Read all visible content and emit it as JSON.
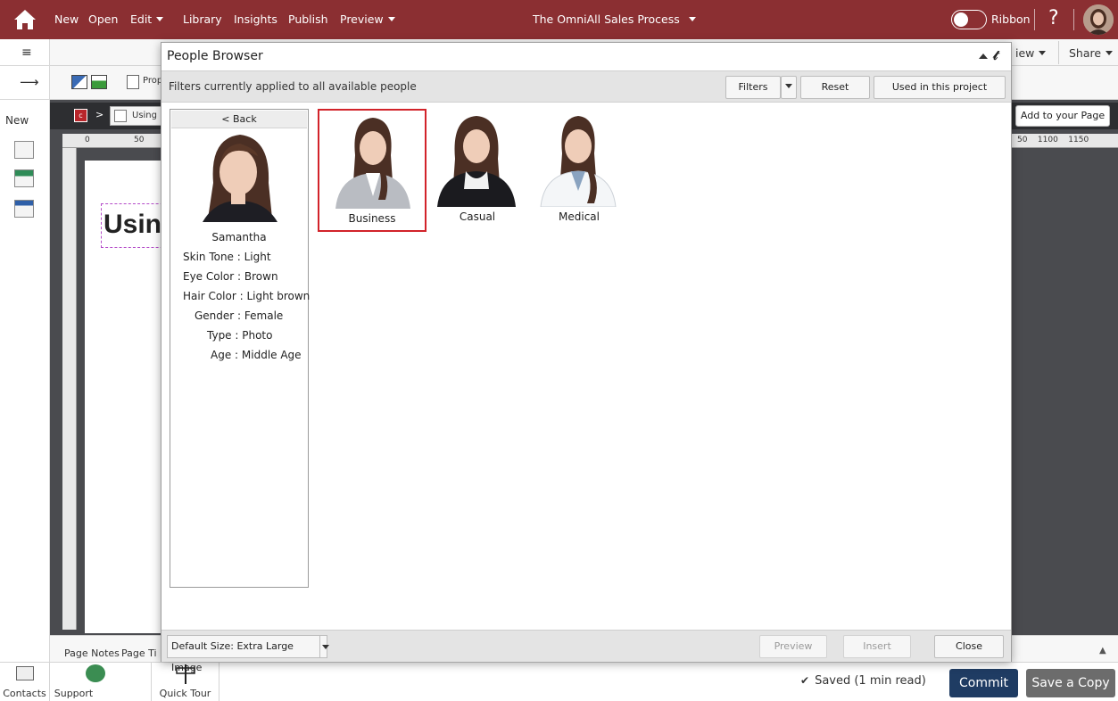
{
  "menu": {
    "new": "New",
    "open": "Open",
    "edit": "Edit",
    "library": "Library",
    "insights": "Insights",
    "publish": "Publish",
    "preview": "Preview",
    "project_title": "The OmniAll Sales Process",
    "ribbon": "Ribbon",
    "help": "?"
  },
  "app": {
    "view_menu": "iew",
    "share_menu": "Share",
    "new_label": "New",
    "toolbar_prop": "Prop",
    "breadcrumb_page": "Using",
    "add_to_page": "Add to your Page",
    "canvas_heading": "Usin",
    "ruler_top_left": [
      "0",
      "50"
    ],
    "ruler_top_right": [
      "50",
      "1100",
      "1150"
    ],
    "page_notes": "Page Notes",
    "page_tab2": "Page Ti"
  },
  "dialog": {
    "title": "People Browser",
    "filter_text": "Filters currently applied to all available people",
    "filters_button": "Filters",
    "reset_button": "Reset",
    "used_button": "Used in this project",
    "back_button": "< Back",
    "person": {
      "name": "Samantha",
      "attributes": [
        {
          "label": "Skin Tone",
          "value": "Light"
        },
        {
          "label": "Eye Color",
          "value": "Brown"
        },
        {
          "label": "Hair Color",
          "value": "Light brown"
        },
        {
          "label": "Gender",
          "value": "Female"
        },
        {
          "label": "Type",
          "value": "Photo"
        },
        {
          "label": "Age",
          "value": "Middle Age"
        }
      ]
    },
    "thumbnails": [
      {
        "label": "Business",
        "selected": true
      },
      {
        "label": "Casual",
        "selected": false
      },
      {
        "label": "Medical",
        "selected": false
      }
    ],
    "default_size": "Default Size: Extra Large Image",
    "preview_button": "Preview",
    "insert_button": "Insert",
    "close_button": "Close"
  },
  "bottom": {
    "contacts": "Contacts",
    "support": "Support",
    "quick_tour": "Quick Tour",
    "saved": "Saved (1 min read)",
    "commit": "Commit",
    "save_copy": "Save a Copy"
  },
  "colors": {
    "topbar": "#8b2f32",
    "commit": "#1f3c63",
    "selection": "#d2232a"
  }
}
